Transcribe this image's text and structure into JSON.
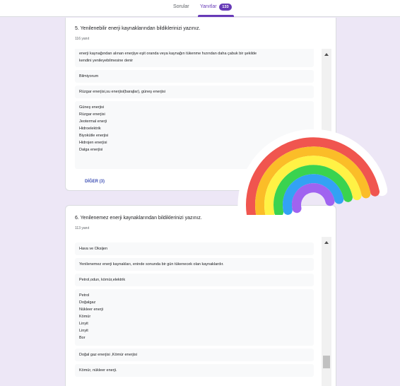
{
  "tabs": {
    "questions_label": "Sorular",
    "responses_label": "Yanıtlar",
    "responses_count": "133"
  },
  "question5": {
    "title": "5. Yenilenebilir enerji kaynaklarından bildiklerinizi yazınız.",
    "count": "116 yanıt",
    "answers": [
      [
        "enerji kaynağından alınan enerjiye eşit oranda veya kaynağın tükenme hızından daha çabuk bir şekilde",
        "kendini yenileyebilmesine denir"
      ],
      [
        "Bilmiyorum"
      ],
      [
        "Rüzgar enerjisi,su enerjisi(barajlar), güneş enerjisi"
      ],
      [
        "Güneş enerjisi",
        "Rüzgar enerjisi",
        "Jeotermal enerji",
        "Hidroelektrik",
        "Biyokütle enerjisi",
        "Hidrojen enerjisi",
        "Dalga enerjisi"
      ]
    ],
    "more_label": "DİĞER (3)"
  },
  "question6": {
    "title": "6. Yenilenemez enerji kaynaklarından bildiklerinizi yazınız.",
    "count": "113 yanıt",
    "answers": [
      [
        "Hava ve Oksijen"
      ],
      [
        "Yenilenemez enerji kaynakları, eninde sonunda bir gün tükenecek olan kaynaklardır."
      ],
      [
        "Petrol,odun, kömür,elektrik"
      ],
      [
        "Petrol",
        "Doğalgaz",
        "Nükleer enerji",
        "Kömür",
        "Linyit",
        "Linyit",
        "Bor"
      ],
      [
        "Doğal gaz enerjisi ,Kömür enerjisi"
      ],
      [
        "Kömür, nükleer enerji."
      ]
    ]
  },
  "colors": {
    "accent": "#673ab7",
    "background": "#ede7f6",
    "link": "#3f51b5",
    "rainbow": [
      "#f0554f",
      "#fbbd28",
      "#fff245",
      "#3ad34f",
      "#33a2f4",
      "#a063f0"
    ]
  },
  "decoration": "rainbow-sticker"
}
